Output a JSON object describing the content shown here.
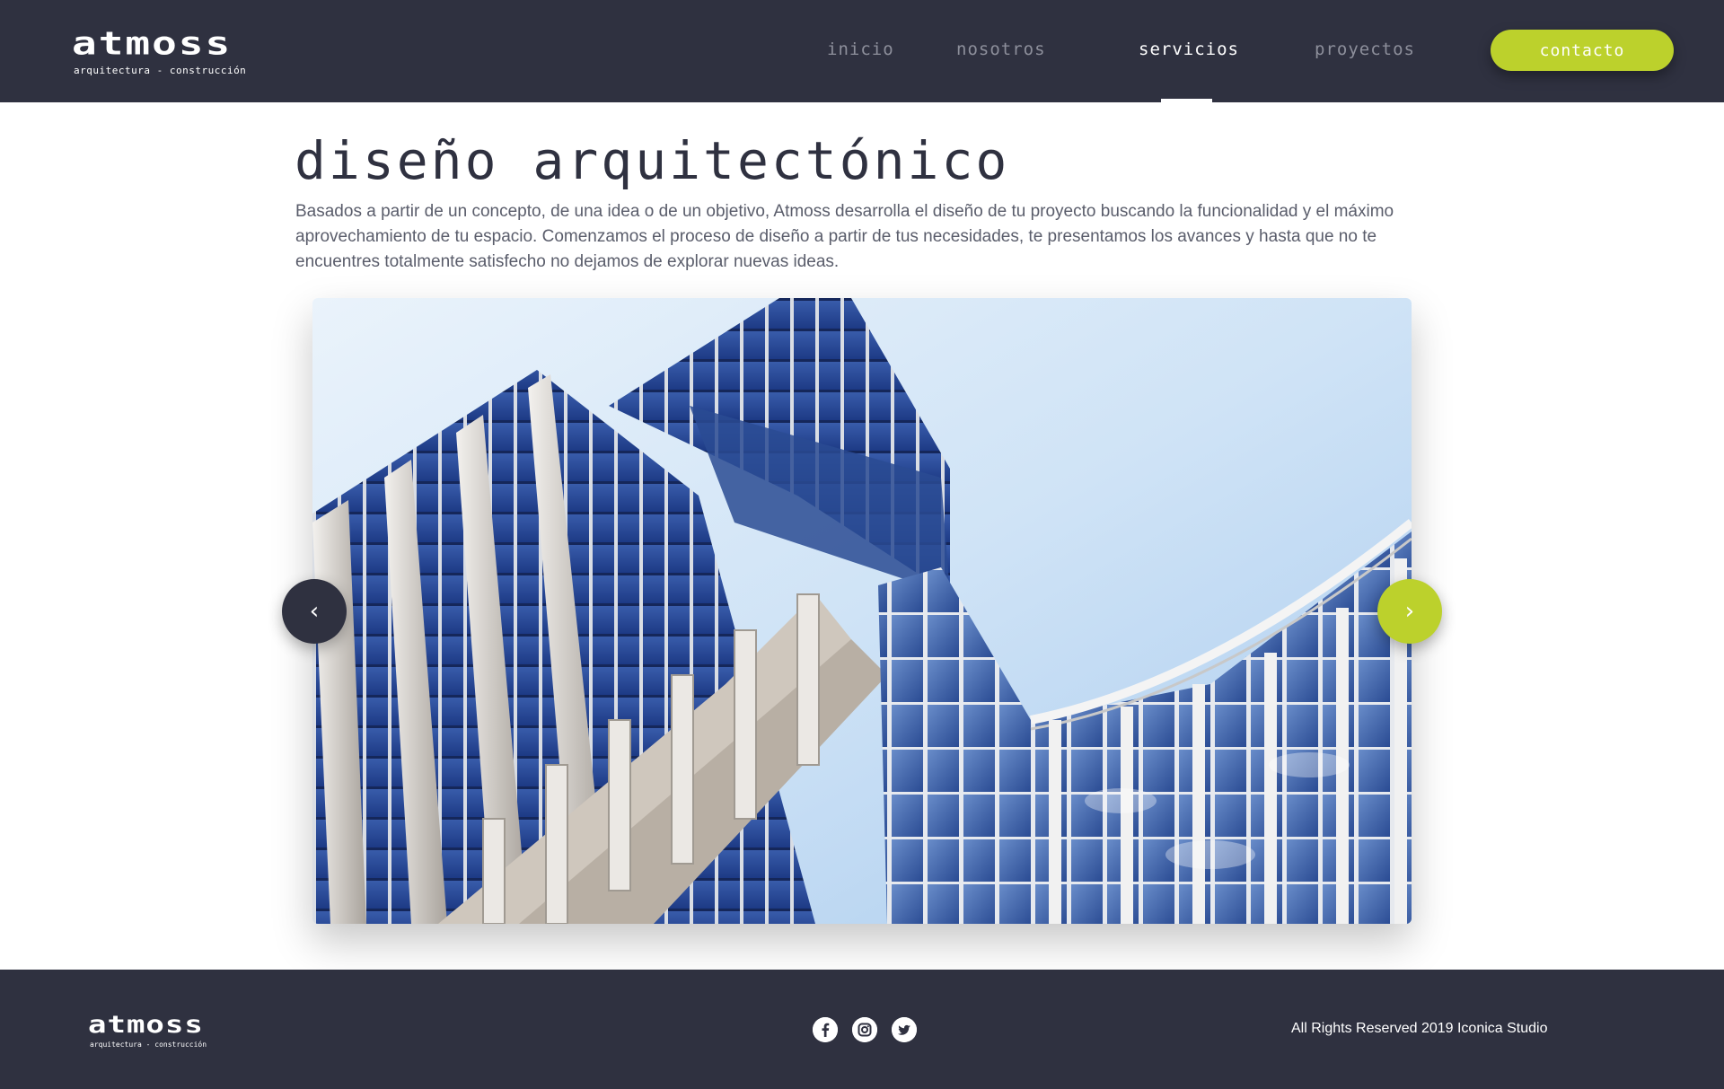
{
  "brand": {
    "name": "atmoss",
    "tagline": "arquitectura - construcción"
  },
  "nav": {
    "items": [
      {
        "label": "inicio",
        "active": false
      },
      {
        "label": "nosotros",
        "active": false
      },
      {
        "label": "servicios",
        "active": true
      },
      {
        "label": "proyectos",
        "active": false
      }
    ],
    "contact_label": "contacto"
  },
  "main": {
    "title": "diseño arquitectónico",
    "description": "Basados a partir de un concepto, de una idea o de un objetivo, Atmoss desarrolla el diseño de tu proyecto buscando la funcionalidad  y el máximo aprovechamiento de tu espacio. Comenzamos el proceso de diseño  a partir de tus necesidades, te presentamos los avances y hasta que no te encuentres totalmente satisfecho no dejamos de explorar nuevas ideas.",
    "carousel": {
      "prev_icon": "chevron-left-icon",
      "next_icon": "chevron-right-icon",
      "prev_glyph": "‹",
      "next_glyph": "›"
    }
  },
  "footer": {
    "brand_name": "atmoss",
    "brand_tagline": "arquitectura - construcción",
    "socials": [
      {
        "name": "facebook-icon",
        "glyph": "f"
      },
      {
        "name": "instagram-icon",
        "glyph": "◎"
      },
      {
        "name": "twitter-icon",
        "glyph": "t"
      }
    ],
    "copyright": "All Rights Reserved 2019 Iconica Studio"
  },
  "colors": {
    "dark": "#2f3140",
    "accent": "#bcd12c",
    "nav_inactive": "#8d8f9b"
  }
}
